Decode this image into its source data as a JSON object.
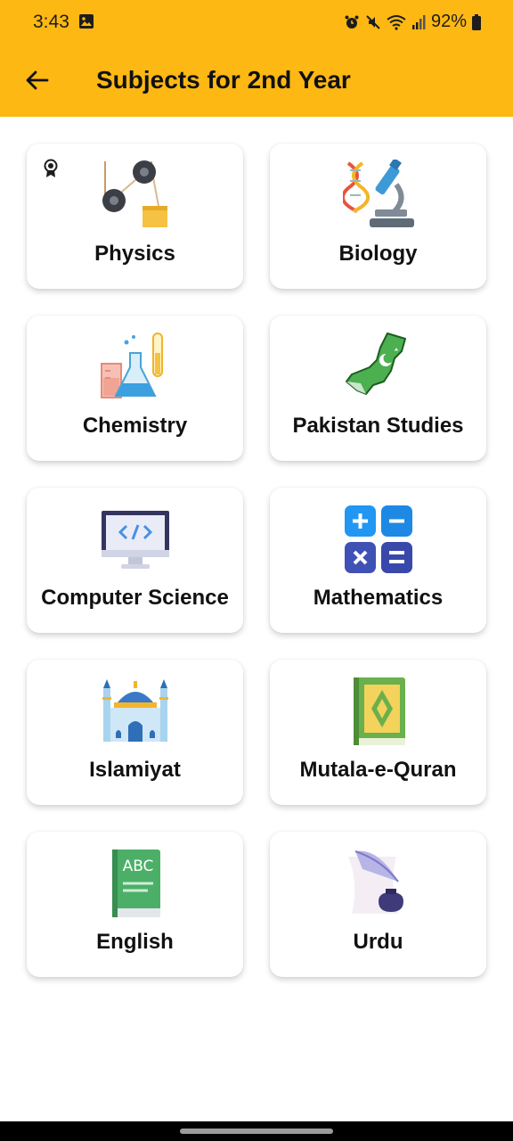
{
  "status_bar": {
    "time": "3:43",
    "battery": "92%"
  },
  "toolbar": {
    "title": "Subjects for 2nd Year"
  },
  "subjects": [
    {
      "label": "Physics",
      "icon": "pulley-icon"
    },
    {
      "label": "Biology",
      "icon": "dna-microscope-icon"
    },
    {
      "label": "Chemistry",
      "icon": "lab-flask-icon"
    },
    {
      "label": "Pakistan Studies",
      "icon": "pakistan-map-icon"
    },
    {
      "label": "Computer Science",
      "icon": "monitor-code-icon"
    },
    {
      "label": "Mathematics",
      "icon": "calculator-operators-icon"
    },
    {
      "label": "Islamiyat",
      "icon": "mosque-icon"
    },
    {
      "label": "Mutala-e-Quran",
      "icon": "quran-book-icon"
    },
    {
      "label": "English",
      "icon": "abc-book-icon"
    },
    {
      "label": "Urdu",
      "icon": "quill-inkpot-icon"
    }
  ]
}
